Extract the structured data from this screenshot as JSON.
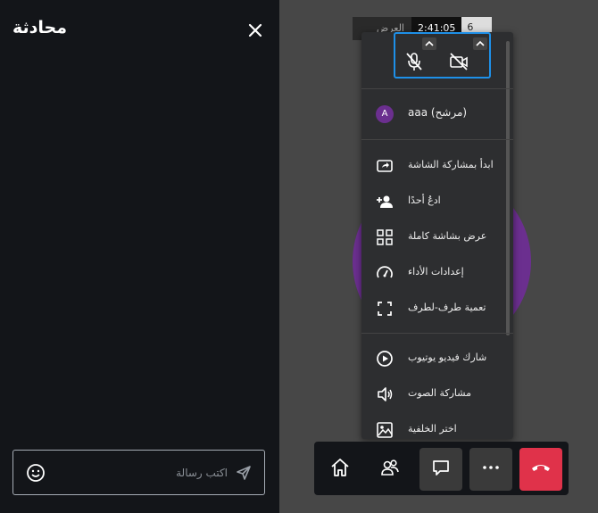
{
  "chat": {
    "title": "محادثة",
    "input_placeholder": "اكتب رسالة"
  },
  "top_bar": {
    "subject": "العرض",
    "timer": "2:41:05",
    "participant_count": "6"
  },
  "menu": {
    "user": {
      "initial": "A",
      "name": "aaa (مرشح)"
    },
    "items": [
      {
        "label": "ابدأ بمشاركة الشاشة",
        "icon": "screen-share-icon"
      },
      {
        "label": "ادعُ أحدًا",
        "icon": "add-person-icon"
      },
      {
        "label": "عرض بشاشة كاملة",
        "icon": "grid-view-icon"
      },
      {
        "label": "إعدادات الأداء",
        "icon": "speedometer-icon"
      },
      {
        "label": "تعمية طرف-لطرف",
        "icon": "fullscreen-icon"
      },
      {
        "label": "شارك فيديو يوتيوب",
        "icon": "play-circle-icon"
      },
      {
        "label": "مشاركة الصوت",
        "icon": "speaker-icon"
      },
      {
        "label": "اختر الخلفية",
        "icon": "image-icon"
      }
    ]
  },
  "colors": {
    "accent_blue": "#1e90e8",
    "hangup_red": "#e0324a",
    "avatar_purple": "#6b2f8f"
  }
}
